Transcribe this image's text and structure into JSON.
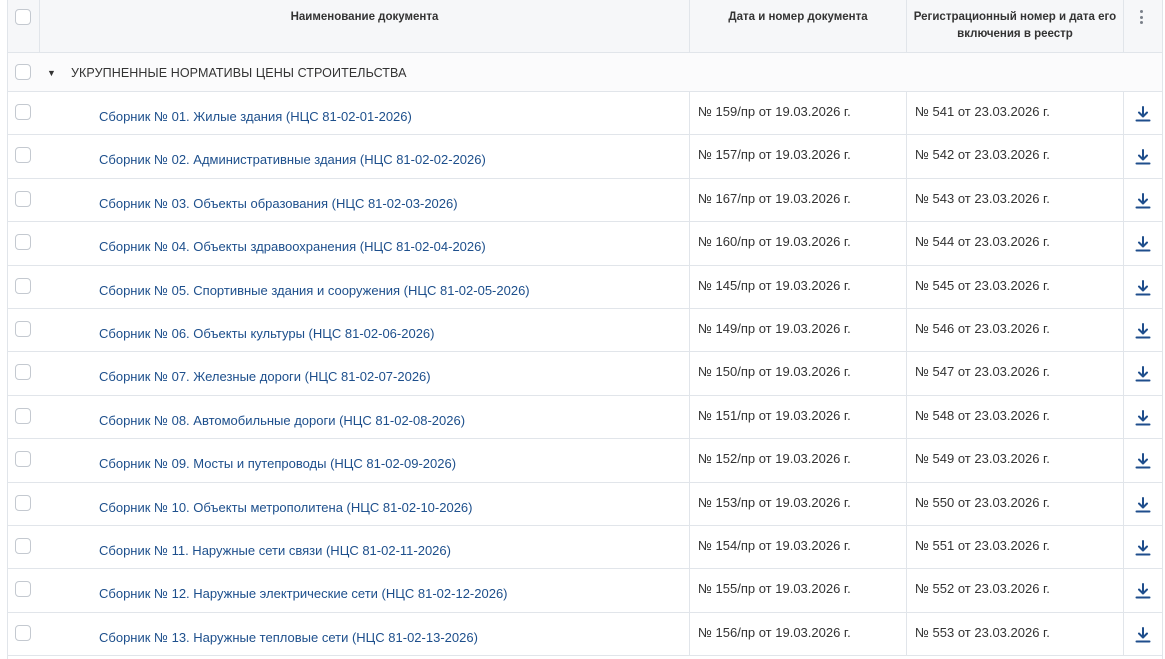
{
  "header": {
    "name_col": "Наименование документа",
    "date_col": "Дата и номер документа",
    "reg_col": "Регистрационный номер и дата его включения в реестр"
  },
  "group": {
    "title": "УКРУПНЕННЫЕ НОРМАТИВЫ ЦЕНЫ СТРОИТЕЛЬСТВА",
    "expanded": true
  },
  "rows": [
    {
      "name": "Сборник № 01. Жилые здания (НЦС 81-02-01-2026)",
      "date": "№ 159/пр от 19.03.2026 г.",
      "reg": "№ 541 от 23.03.2026 г."
    },
    {
      "name": "Сборник № 02. Административные здания (НЦС 81-02-02-2026)",
      "date": "№ 157/пр от 19.03.2026 г.",
      "reg": "№ 542 от 23.03.2026 г."
    },
    {
      "name": "Сборник № 03. Объекты образования (НЦС 81-02-03-2026)",
      "date": "№ 167/пр от 19.03.2026 г.",
      "reg": "№ 543 от 23.03.2026 г."
    },
    {
      "name": "Сборник № 04. Объекты здравоохранения (НЦС 81-02-04-2026)",
      "date": "№ 160/пр от 19.03.2026 г.",
      "reg": "№ 544 от 23.03.2026 г."
    },
    {
      "name": "Сборник № 05. Спортивные здания и сооружения (НЦС 81-02-05-2026)",
      "date": "№ 145/пр от 19.03.2026 г.",
      "reg": "№ 545 от 23.03.2026 г."
    },
    {
      "name": "Сборник № 06. Объекты культуры (НЦС 81-02-06-2026)",
      "date": "№ 149/пр от 19.03.2026 г.",
      "reg": "№ 546 от 23.03.2026 г."
    },
    {
      "name": "Сборник № 07. Железные дороги (НЦС 81-02-07-2026)",
      "date": "№ 150/пр от 19.03.2026 г.",
      "reg": "№ 547 от 23.03.2026 г."
    },
    {
      "name": "Сборник № 08. Автомобильные дороги (НЦС 81-02-08-2026)",
      "date": "№ 151/пр от 19.03.2026 г.",
      "reg": "№ 548 от 23.03.2026 г."
    },
    {
      "name": "Сборник № 09. Мосты и путепроводы (НЦС 81-02-09-2026)",
      "date": "№ 152/пр от 19.03.2026 г.",
      "reg": "№ 549 от 23.03.2026 г."
    },
    {
      "name": "Сборник № 10. Объекты метрополитена (НЦС 81-02-10-2026)",
      "date": "№ 153/пр от 19.03.2026 г.",
      "reg": "№ 550 от 23.03.2026 г."
    },
    {
      "name": "Сборник № 11. Наружные сети связи (НЦС 81-02-11-2026)",
      "date": "№ 154/пр от 19.03.2026 г.",
      "reg": "№ 551 от 23.03.2026 г."
    },
    {
      "name": "Сборник № 12. Наружные электрические сети (НЦС 81-02-12-2026)",
      "date": "№ 155/пр от 19.03.2026 г.",
      "reg": "№ 552 от 23.03.2026 г."
    },
    {
      "name": "Сборник № 13. Наружные тепловые сети (НЦС 81-02-13-2026)",
      "date": "№ 156/пр от 19.03.2026 г.",
      "reg": "№ 553 от 23.03.2026 г."
    }
  ],
  "colors": {
    "link": "#1d4f8c",
    "download_icon": "#1f4e8c",
    "border": "#e1e5ea"
  },
  "icons": {
    "row_action": "download-icon",
    "column_menu": "kebab-icon",
    "group_toggle": "caret-down-icon"
  }
}
